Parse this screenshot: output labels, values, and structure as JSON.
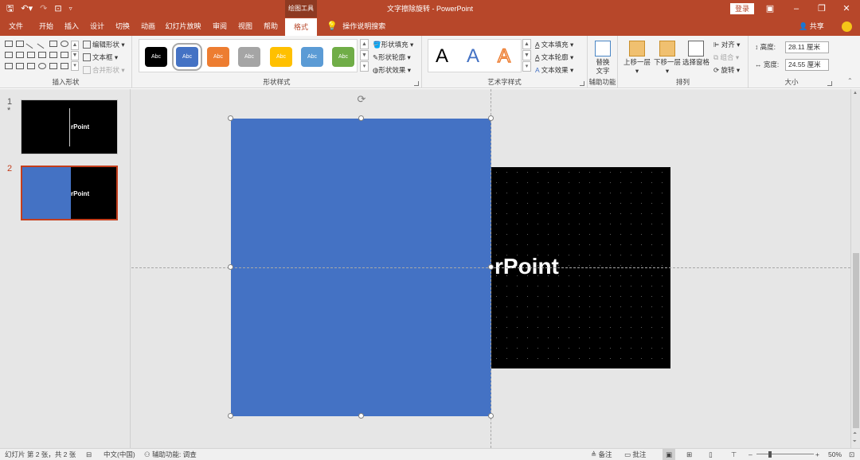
{
  "titlebar": {
    "contextual_tab": "绘图工具",
    "doc_title": "文字擦除旋转 - PowerPoint",
    "login": "登录",
    "qat_icons": [
      "save-icon",
      "undo-icon",
      "redo-icon",
      "start-from-beginning-icon",
      "customize-qat-icon"
    ],
    "colors": {
      "brand": "#b7472a"
    }
  },
  "tabs": [
    "文件",
    "开始",
    "插入",
    "设计",
    "切换",
    "动画",
    "幻灯片放映",
    "审阅",
    "视图",
    "帮助",
    "格式"
  ],
  "active_tab": "格式",
  "help_search": "操作说明搜索",
  "share": "共享",
  "ribbon": {
    "insert_shapes": {
      "label": "插入形状",
      "edit_shape": "编辑形状",
      "text_box": "文本框",
      "merge_shapes": "合并形状"
    },
    "shape_styles": {
      "label": "形状样式",
      "swatch_text": "Abc",
      "swatches": [
        "#000000",
        "#4472c4",
        "#ed7d31",
        "#a5a5a5",
        "#ffc000",
        "#5b9bd5",
        "#70ad47"
      ],
      "fill": "形状填充",
      "outline": "形状轮廓",
      "effects": "形状效果"
    },
    "wordart": {
      "label": "艺术字样式",
      "letters": [
        "A",
        "A",
        "A"
      ],
      "fill": "文本填充",
      "outline": "文本轮廓",
      "effects": "文本效果"
    },
    "accessibility": {
      "label": "辅助功能",
      "alt_text_line1": "替换",
      "alt_text_line2": "文字"
    },
    "arrange": {
      "label": "排列",
      "bring_forward": "上移一层",
      "send_backward": "下移一层",
      "selection_pane": "选择窗格",
      "align": "对齐",
      "group": "组合",
      "rotate": "旋转"
    },
    "size": {
      "label": "大小",
      "height_label": "高度:",
      "height_value": "28.11 厘米",
      "width_label": "宽度:",
      "width_value": "24.55 厘米"
    }
  },
  "slides": [
    {
      "number": "1",
      "marker": "*",
      "text": "rPoint"
    },
    {
      "number": "2",
      "marker": "",
      "text": "rPoint"
    }
  ],
  "canvas": {
    "slide_text": "rPoint",
    "shape_color": "#4472c4"
  },
  "statusbar": {
    "slide_info": "幻灯片 第 2 张，共 2 张",
    "language": "中文(中国)",
    "accessibility": "辅助功能: 调查",
    "notes": "备注",
    "comments": "批注",
    "zoom": "50%"
  }
}
